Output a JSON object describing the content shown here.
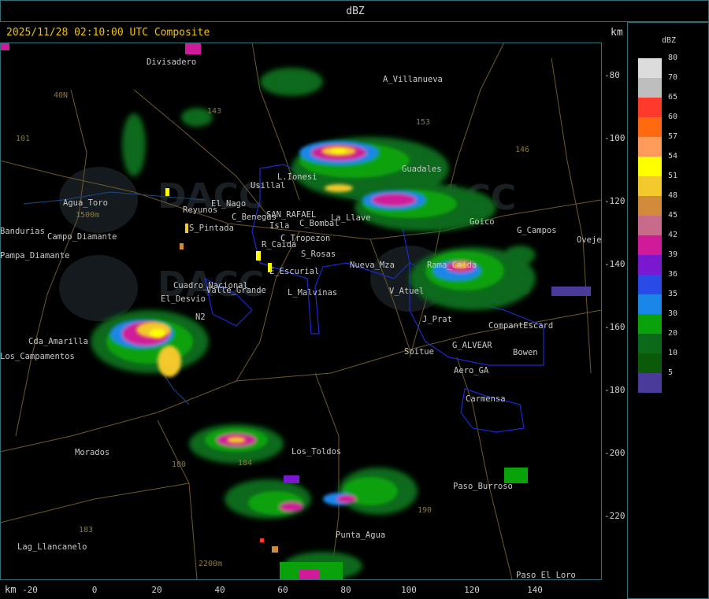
{
  "header": {
    "title": "dBZ"
  },
  "timestamp": "2025/11/28 02:10:00 UTC Composite",
  "units": {
    "km_top": "km",
    "km_bottom": "km"
  },
  "y_axis_ticks": [
    "-80",
    "-100",
    "-120",
    "-140",
    "-160",
    "-180",
    "-200",
    "-220"
  ],
  "x_axis_ticks": [
    "-20",
    "0",
    "20",
    "40",
    "60",
    "80",
    "100",
    "120",
    "140"
  ],
  "legend": {
    "title": "dBZ",
    "items": [
      {
        "label": "80",
        "color": "#dcdcdc"
      },
      {
        "label": "70",
        "color": "#bebebe"
      },
      {
        "label": "65",
        "color": "#ff3a2a"
      },
      {
        "label": "60",
        "color": "#ff6a10"
      },
      {
        "label": "57",
        "color": "#ff9a5a"
      },
      {
        "label": "54",
        "color": "#ffff00"
      },
      {
        "label": "51",
        "color": "#f2c82a"
      },
      {
        "label": "48",
        "color": "#d08a3a"
      },
      {
        "label": "45",
        "color": "#c86a8a"
      },
      {
        "label": "42",
        "color": "#d01a9a"
      },
      {
        "label": "39",
        "color": "#7a18d0"
      },
      {
        "label": "36",
        "color": "#2a4ae8"
      },
      {
        "label": "35",
        "color": "#1a86e8"
      },
      {
        "label": "30",
        "color": "#0aa20a"
      },
      {
        "label": "20",
        "color": "#0a6a1a"
      },
      {
        "label": "10",
        "color": "#0a5a0a"
      },
      {
        "label": "5",
        "color": "#4a3a9a"
      }
    ]
  },
  "places": [
    {
      "name": "Divisadero"
    },
    {
      "name": "A_Villanueva"
    },
    {
      "name": "40N"
    },
    {
      "name": "101"
    },
    {
      "name": "153"
    },
    {
      "name": "146"
    },
    {
      "name": "Guadales"
    },
    {
      "name": "143"
    },
    {
      "name": "L.Ionesi"
    },
    {
      "name": "Usillal"
    },
    {
      "name": "Agua_Toro"
    },
    {
      "name": "1500m"
    },
    {
      "name": "Reyunos"
    },
    {
      "name": "El_Nago"
    },
    {
      "name": "C_Benegas"
    },
    {
      "name": "SAN_RAFAEL"
    },
    {
      "name": "La_Llave"
    },
    {
      "name": "Goico"
    },
    {
      "name": "G_Campos"
    },
    {
      "name": "Ovejeria"
    },
    {
      "name": "S_Pintada"
    },
    {
      "name": "Isla"
    },
    {
      "name": "C_Bombal"
    },
    {
      "name": "C_Tropezon"
    },
    {
      "name": "R_Caida"
    },
    {
      "name": "S_Rosas"
    },
    {
      "name": "Nueva_Mza"
    },
    {
      "name": "Rama_Caida"
    },
    {
      "name": "E_Escurial"
    },
    {
      "name": "Valle_Grande"
    },
    {
      "name": "L_Malvinas"
    },
    {
      "name": "V_Atuel"
    },
    {
      "name": "El_Desvio"
    },
    {
      "name": "Cda_Amarilla"
    },
    {
      "name": "Soitue"
    },
    {
      "name": "G_ALVEAR"
    },
    {
      "name": "Bowen"
    },
    {
      "name": "Aero_GA"
    },
    {
      "name": "Carmensa"
    },
    {
      "name": "Morados"
    },
    {
      "name": "180"
    },
    {
      "name": "184"
    },
    {
      "name": "Los_Toldos"
    },
    {
      "name": "Paso_Burroso"
    },
    {
      "name": "183"
    },
    {
      "name": "190"
    },
    {
      "name": "Punta_Agua"
    },
    {
      "name": "Lag_Llancanelo"
    },
    {
      "name": "2200m"
    },
    {
      "name": "Paso_El_Loro"
    },
    {
      "name": "Campo_Diamante"
    },
    {
      "name": "Bandurias"
    },
    {
      "name": "Pampa_Diamante"
    },
    {
      "name": "Los_Campamentos"
    },
    {
      "name": "CompantEscard"
    },
    {
      "name": "J_Prat"
    },
    {
      "name": "N2"
    },
    {
      "name": "Cuadro_Nacional"
    }
  ],
  "watermark": {
    "text": "DACC"
  }
}
